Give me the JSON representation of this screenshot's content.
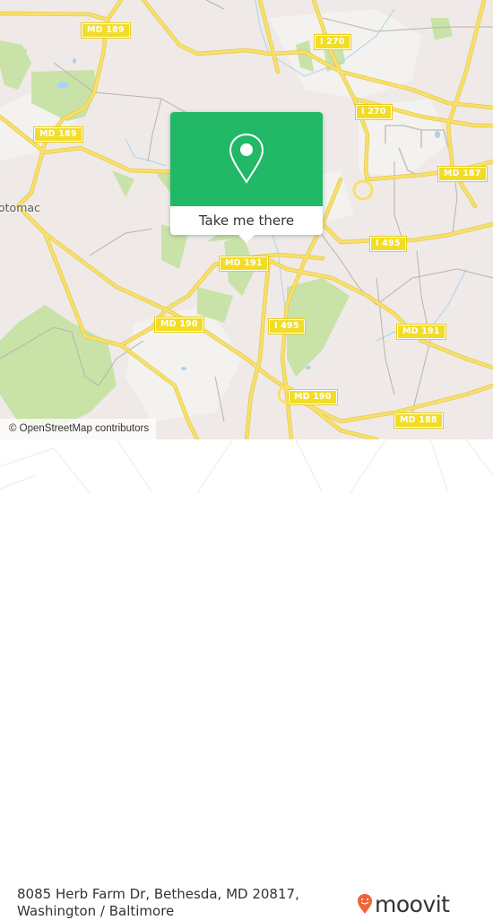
{
  "map": {
    "attribution": "© OpenStreetMap contributors",
    "place_labels": [
      {
        "id": "potomac",
        "text": "otomac"
      }
    ],
    "road_shields": [
      {
        "id": "md189-top",
        "text": "MD 189"
      },
      {
        "id": "md189-left",
        "text": "MD 189"
      },
      {
        "id": "i270-top",
        "text": "I 270"
      },
      {
        "id": "i270-mid",
        "text": "I 270"
      },
      {
        "id": "md187",
        "text": "MD 187"
      },
      {
        "id": "i495-east",
        "text": "I 495"
      },
      {
        "id": "md191-center",
        "text": "MD 191"
      },
      {
        "id": "md190-west",
        "text": "MD 190"
      },
      {
        "id": "i495-south",
        "text": "I 495"
      },
      {
        "id": "md191-east",
        "text": "MD 191"
      },
      {
        "id": "md190-south",
        "text": "MD 190"
      },
      {
        "id": "md188",
        "text": "MD 188"
      }
    ],
    "colors": {
      "land": "#efeae7",
      "park": "#c8e2a8",
      "road_major": "#f7dc5c",
      "shield": "#f2dc26",
      "water": "#a9d3f0"
    }
  },
  "popup": {
    "icon": "map-pin-icon",
    "button_label": "Take me there",
    "accent": "#21b868"
  },
  "footer": {
    "address_line1": "8085 Herb Farm Dr, Bethesda, MD 20817,",
    "address_line2": "Washington / Baltimore",
    "logo_text": "moovit",
    "logo_color": "#f0643a"
  }
}
